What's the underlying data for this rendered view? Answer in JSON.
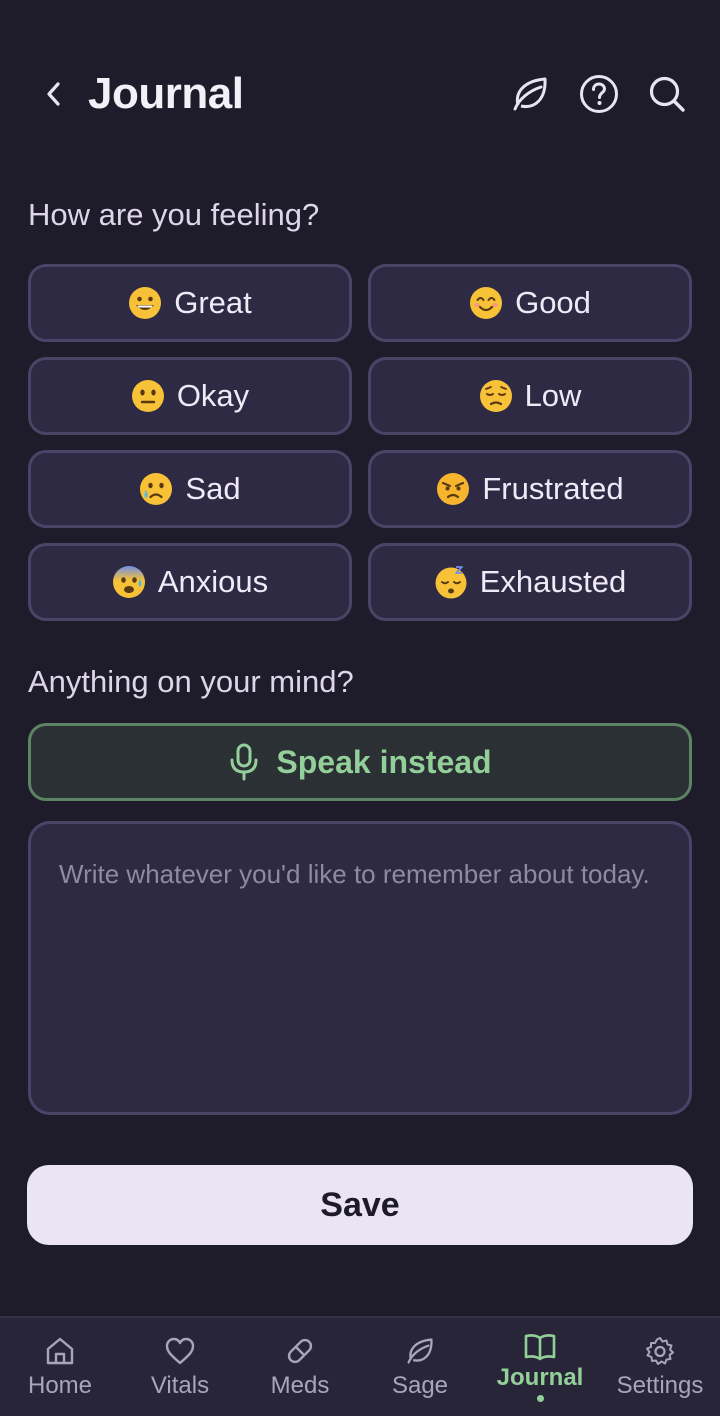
{
  "header": {
    "title": "Journal",
    "icons": [
      "back-chevron-icon",
      "leaf-icon",
      "help-icon",
      "search-icon"
    ]
  },
  "mood_section": {
    "title": "How are you feeling?",
    "moods": [
      {
        "label": "Great",
        "emoji": "grinning-face"
      },
      {
        "label": "Good",
        "emoji": "smiling-face"
      },
      {
        "label": "Okay",
        "emoji": "neutral-face"
      },
      {
        "label": "Low",
        "emoji": "pensive-face"
      },
      {
        "label": "Sad",
        "emoji": "crying-face"
      },
      {
        "label": "Frustrated",
        "emoji": "angry-face"
      },
      {
        "label": "Anxious",
        "emoji": "anxious-face"
      },
      {
        "label": "Exhausted",
        "emoji": "sleeping-face"
      }
    ]
  },
  "mind_section": {
    "title": "Anything on your mind?",
    "speak_label": "Speak instead",
    "note_placeholder": "Write whatever you'd like to remember about today.",
    "note_value": ""
  },
  "save_label": "Save",
  "colors": {
    "background": "#1e1c2b",
    "card": "#2e2a44",
    "accent_green": "#93cf98",
    "save_bg": "#ebe5f3"
  },
  "bottom_nav": {
    "items": [
      {
        "label": "Home",
        "icon": "home-icon"
      },
      {
        "label": "Vitals",
        "icon": "heart-icon"
      },
      {
        "label": "Meds",
        "icon": "pill-icon"
      },
      {
        "label": "Sage",
        "icon": "leaf-icon"
      },
      {
        "label": "Journal",
        "icon": "book-icon",
        "active": true
      },
      {
        "label": "Settings",
        "icon": "gear-icon"
      }
    ]
  }
}
